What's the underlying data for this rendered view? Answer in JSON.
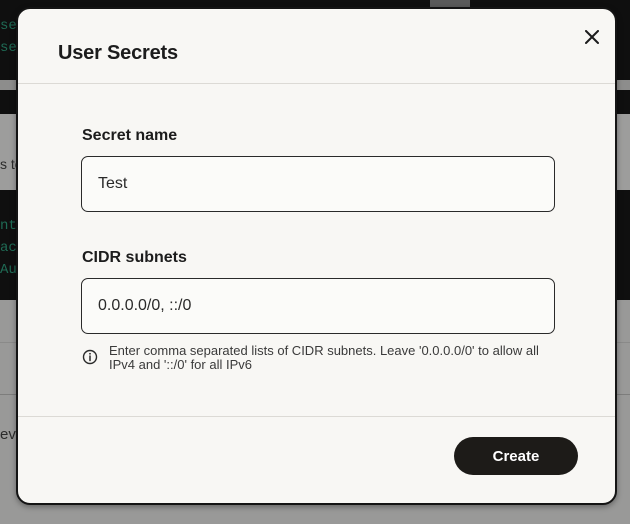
{
  "background": {
    "fragments": [
      "se",
      "se",
      "s to",
      "nt",
      "ac",
      "Au",
      "ev"
    ]
  },
  "modal": {
    "title": "User Secrets",
    "close_icon": "close-icon",
    "secret_name": {
      "label": "Secret name",
      "value": "Test"
    },
    "cidr_subnets": {
      "label": "CIDR subnets",
      "value": "0.0.0.0/0, ::/0"
    },
    "hint": {
      "icon": "info-icon",
      "text": "Enter comma separated lists of CIDR subnets. Leave '0.0.0.0/0' to allow all IPv4 and '::/0' for all IPv6"
    },
    "create_label": "Create"
  },
  "colors": {
    "overlay": "#9a9a99",
    "modal_bg": "#f8f7f4",
    "primary_button": "#1d1b18",
    "code_bg": "#0f0f0f",
    "code_text": "#1f6b55"
  }
}
